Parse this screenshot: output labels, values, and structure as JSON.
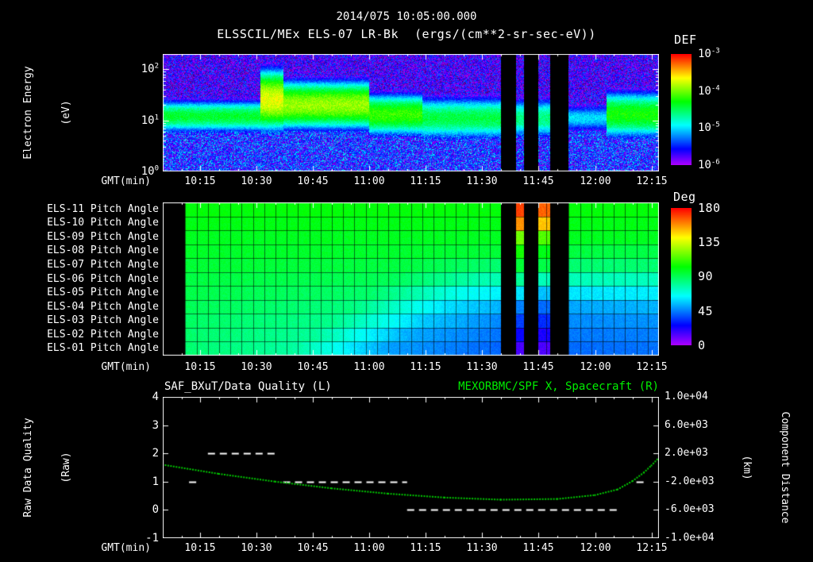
{
  "header": {
    "datetime": "2014/075 10:05:00.000",
    "instrument_title": "ELSSCIL/MEx ELS-07 LR-Bk",
    "units_title": "(ergs/(cm**2-sr-sec-eV))"
  },
  "time_axis": {
    "label": "GMT(min)",
    "range": [
      "10:05",
      "12:17"
    ],
    "ticks": [
      "10:15",
      "10:30",
      "10:45",
      "11:00",
      "11:15",
      "11:30",
      "11:45",
      "12:00",
      "12:15"
    ]
  },
  "chart_data": [
    {
      "id": "electron-energy-spectrogram",
      "type": "heatmap",
      "title": "ELSSCIL/MEx ELS-07 LR-Bk",
      "units": "ergs/(cm**2-sr-sec-eV)",
      "xlabel": "GMT(min)",
      "ylabel_line1": "Electron Energy",
      "ylabel_line2": "(eV)",
      "y_scale": "log",
      "energy_range_ev": [
        1,
        200
      ],
      "y_ticks": [
        {
          "base": "10",
          "exp": "2"
        },
        {
          "base": "10",
          "exp": "1"
        },
        {
          "base": "10",
          "exp": "0"
        }
      ],
      "colorbar": {
        "title": "DEF",
        "scale": "log",
        "range_log10": [
          -6,
          -3
        ],
        "ticks": [
          {
            "base": "10",
            "exp": "-3"
          },
          {
            "base": "10",
            "exp": "-4"
          },
          {
            "base": "10",
            "exp": "-5"
          },
          {
            "base": "10",
            "exp": "-6"
          }
        ]
      },
      "background_log10_flux": -5.8,
      "data_gaps_gmt": [
        [
          "11:35",
          "11:39"
        ],
        [
          "11:41",
          "11:45"
        ],
        [
          "11:48",
          "11:53"
        ]
      ],
      "band_segments": [
        {
          "t": [
            "10:05",
            "10:31"
          ],
          "center_ev": 12,
          "width_decades": 0.32,
          "peak_log10_flux": -4.4
        },
        {
          "t": [
            "10:31",
            "10:37"
          ],
          "center_ev": 25,
          "width_decades": 0.55,
          "peak_log10_flux": -3.7
        },
        {
          "t": [
            "10:37",
            "11:00"
          ],
          "center_ev": 20,
          "width_decades": 0.45,
          "peak_log10_flux": -3.9
        },
        {
          "t": [
            "11:00",
            "11:14"
          ],
          "center_ev": 13,
          "width_decades": 0.4,
          "peak_log10_flux": -4.15
        },
        {
          "t": [
            "11:14",
            "11:35"
          ],
          "center_ev": 11,
          "width_decades": 0.42,
          "peak_log10_flux": -4.45
        },
        {
          "t": [
            "11:39",
            "11:48"
          ],
          "center_ev": 11,
          "width_decades": 0.4,
          "peak_log10_flux": -4.6
        },
        {
          "t": [
            "11:53",
            "12:03"
          ],
          "center_ev": 11,
          "width_decades": 0.3,
          "peak_log10_flux": -5.0
        },
        {
          "t": [
            "12:03",
            "12:17"
          ],
          "center_ev": 13,
          "width_decades": 0.45,
          "peak_log10_flux": -4.25
        }
      ]
    },
    {
      "id": "pitch-angle-heatmap",
      "type": "heatmap",
      "xlabel": "GMT(min)",
      "row_labels": [
        "ELS-11 Pitch Angle",
        "ELS-10 Pitch Angle",
        "ELS-09 Pitch Angle",
        "ELS-08 Pitch Angle",
        "ELS-07 Pitch Angle",
        "ELS-06 Pitch Angle",
        "ELS-05 Pitch Angle",
        "ELS-04 Pitch Angle",
        "ELS-03 Pitch Angle",
        "ELS-02 Pitch Angle",
        "ELS-01 Pitch Angle"
      ],
      "colorbar": {
        "title": "Deg",
        "range_deg": [
          0,
          180
        ],
        "ticks": [
          "180",
          "135",
          "90",
          "45",
          "0"
        ]
      },
      "data_start": "10:11",
      "grid_minutes": 3,
      "data_gaps_gmt": [
        [
          "11:35",
          "11:39"
        ],
        [
          "11:41",
          "11:45"
        ],
        [
          "11:48",
          "11:53"
        ]
      ],
      "rows_deg_profiles": [
        [
          [
            "10:11",
            102
          ],
          [
            "12:17",
            102
          ]
        ],
        [
          [
            "10:11",
            100
          ],
          [
            "12:17",
            100
          ]
        ],
        [
          [
            "10:11",
            98
          ],
          [
            "12:17",
            98
          ]
        ],
        [
          [
            "10:11",
            97
          ],
          [
            "11:10",
            96
          ],
          [
            "12:17",
            92
          ]
        ],
        [
          [
            "10:11",
            95
          ],
          [
            "11:10",
            93
          ],
          [
            "11:35",
            86
          ],
          [
            "12:17",
            86
          ]
        ],
        [
          [
            "10:11",
            93
          ],
          [
            "11:05",
            90
          ],
          [
            "11:30",
            76
          ],
          [
            "12:17",
            74
          ]
        ],
        [
          [
            "10:11",
            92
          ],
          [
            "11:00",
            87
          ],
          [
            "11:25",
            66
          ],
          [
            "11:45",
            60
          ],
          [
            "12:17",
            62
          ]
        ],
        [
          [
            "10:11",
            90
          ],
          [
            "10:55",
            84
          ],
          [
            "11:20",
            60
          ],
          [
            "11:40",
            50
          ],
          [
            "12:17",
            53
          ]
        ],
        [
          [
            "10:11",
            88
          ],
          [
            "10:50",
            82
          ],
          [
            "11:15",
            56
          ],
          [
            "11:35",
            46
          ],
          [
            "12:17",
            48
          ]
        ],
        [
          [
            "10:11",
            87
          ],
          [
            "10:45",
            80
          ],
          [
            "11:10",
            52
          ],
          [
            "11:35",
            43
          ],
          [
            "12:17",
            45
          ]
        ],
        [
          [
            "10:11",
            86
          ],
          [
            "10:40",
            79
          ],
          [
            "11:05",
            50
          ],
          [
            "11:35",
            41
          ],
          [
            "12:17",
            43
          ]
        ]
      ],
      "column_events": [
        {
          "t": [
            "11:39",
            "11:41"
          ],
          "values_deg": [
            170,
            158,
            120,
            105,
            95,
            80,
            60,
            45,
            35,
            25,
            15
          ]
        },
        {
          "t": [
            "11:45",
            "11:48"
          ],
          "values_deg": [
            165,
            150,
            115,
            100,
            92,
            75,
            55,
            42,
            32,
            22,
            14
          ]
        }
      ]
    },
    {
      "id": "quality-distance-line-plot",
      "type": "line",
      "left_title": "SAF_BXuT/Data Quality (L)",
      "right_title": "MEXORBMC/SPF X, Spacecraft (R)",
      "right_title_color": "#00ee00",
      "xlabel": "GMT(min)",
      "left_axis": {
        "label_line1": "Raw Data Quality",
        "label_line2": "(Raw)",
        "range": [
          -1,
          4
        ],
        "ticks": [
          "4",
          "3",
          "2",
          "1",
          "0",
          "-1"
        ]
      },
      "right_axis": {
        "label_line1": "Component Distance",
        "label_line2": "(km)",
        "range_km": [
          -10000,
          10000
        ],
        "ticks": [
          "1.0e+04",
          "6.0e+03",
          "2.0e+03",
          "-2.0e+03",
          "-6.0e+03",
          "-1.0e+04"
        ]
      },
      "series": [
        {
          "name": "SAF_BXuT/Data Quality",
          "axis": "left",
          "style": "dashed",
          "color": "#ffffff",
          "segments": [
            {
              "level": 1,
              "t": [
                "10:12",
                "10:14"
              ]
            },
            {
              "level": 2,
              "t": [
                "10:17",
                "10:36"
              ]
            },
            {
              "level": 1,
              "t": [
                "10:37",
                "11:10"
              ]
            },
            {
              "level": 0,
              "t": [
                "11:10",
                "12:07"
              ]
            },
            {
              "level": 1,
              "t": [
                "12:11",
                "12:13"
              ]
            }
          ]
        },
        {
          "name": "MEXORBMC/SPF X, Spacecraft",
          "axis": "right",
          "style": "dotted",
          "color": "#00cc00",
          "points_gmt_km": [
            [
              "10:05",
              400
            ],
            [
              "10:20",
              -900
            ],
            [
              "10:35",
              -2000
            ],
            [
              "10:50",
              -2950
            ],
            [
              "11:05",
              -3700
            ],
            [
              "11:20",
              -4250
            ],
            [
              "11:35",
              -4550
            ],
            [
              "11:50",
              -4450
            ],
            [
              "12:00",
              -3900
            ],
            [
              "12:06",
              -3100
            ],
            [
              "12:10",
              -1900
            ],
            [
              "12:13",
              -700
            ],
            [
              "12:15",
              300
            ],
            [
              "12:17",
              1400
            ]
          ]
        }
      ]
    }
  ]
}
